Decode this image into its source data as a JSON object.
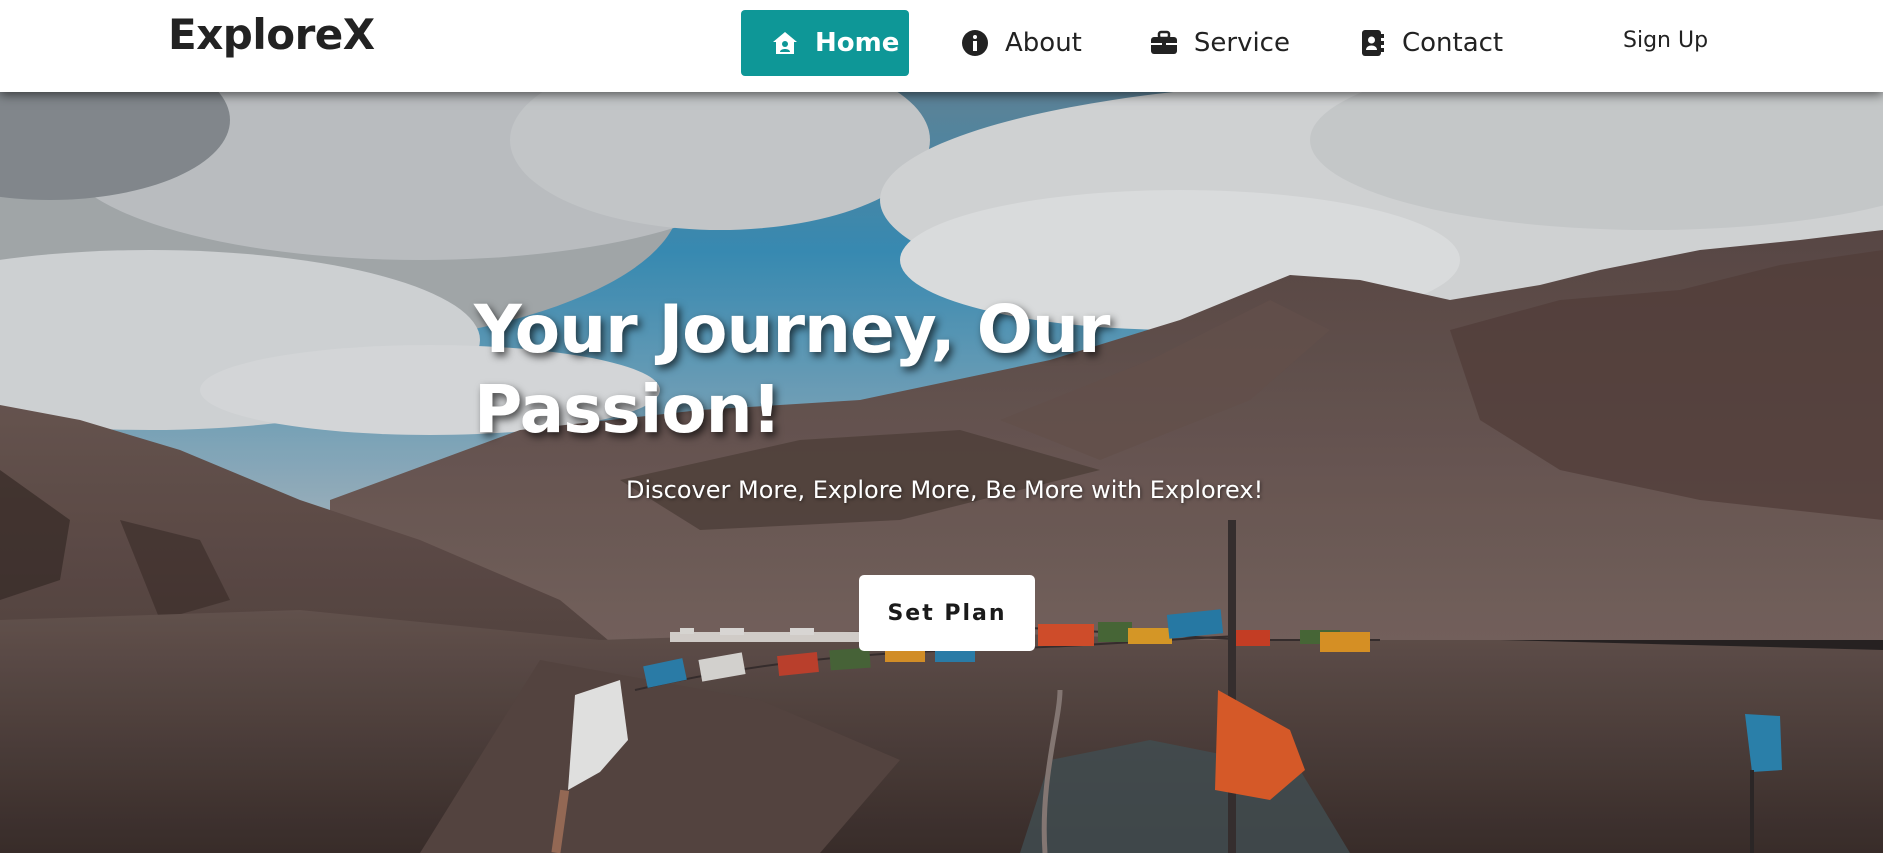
{
  "navbar": {
    "brand": "ExploreX",
    "items": [
      {
        "label": "Home",
        "icon": "house-user-icon",
        "active": true
      },
      {
        "label": "About",
        "icon": "info-circle-icon",
        "active": false
      },
      {
        "label": "Service",
        "icon": "briefcase-icon",
        "active": false
      },
      {
        "label": "Contact",
        "icon": "address-book-icon",
        "active": false
      }
    ],
    "signup_label": "Sign Up"
  },
  "hero": {
    "title": "Your Journey, Our Passion!",
    "subtitle": "Discover More, Explore More, Be More with Explorex!",
    "cta_label": "Set Plan",
    "background": "mountain-valley-prayer-flags"
  },
  "colors": {
    "accent": "#0e9797",
    "nav_background": "#ffffff",
    "text_dark": "#222222",
    "hero_text": "#ffffff"
  }
}
